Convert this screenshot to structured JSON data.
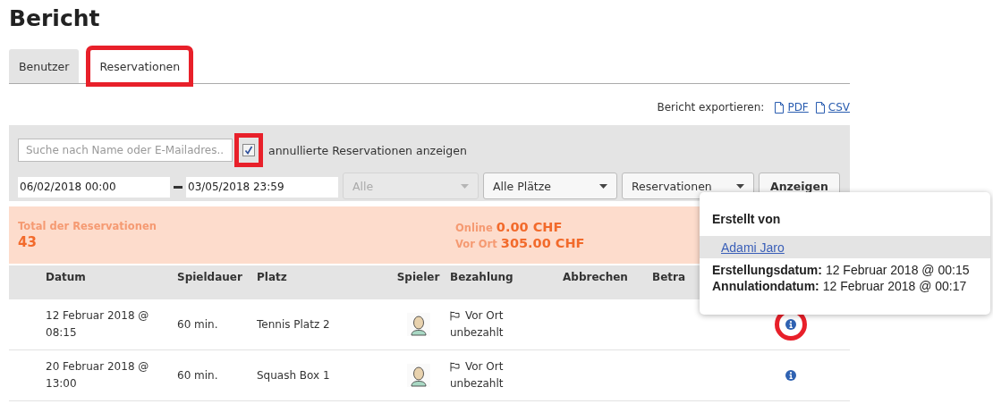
{
  "page_title": "Bericht",
  "tabs": [
    {
      "label": "Benutzer",
      "selected": false,
      "highlighted": false
    },
    {
      "label": "Reservationen",
      "selected": true,
      "highlighted": true
    }
  ],
  "export": {
    "label": "Bericht exportieren:",
    "links": [
      "PDF",
      "CSV"
    ]
  },
  "filters": {
    "search": {
      "placeholder": "Suche nach Name oder E-Mailadres..."
    },
    "show_cancelled": {
      "label": "annullierte Reservationen anzeigen",
      "checked": true,
      "highlighted": true
    },
    "date_from": "06/02/2018 00:00",
    "date_to": "03/05/2018 23:59",
    "selects": [
      {
        "value": "Alle",
        "disabled": true
      },
      {
        "value": "Alle Plätze",
        "disabled": false
      },
      {
        "value": "Reservationen",
        "disabled": false
      }
    ],
    "submit": "Anzeigen"
  },
  "summary": {
    "total_label": "Total der Reservationen",
    "total": "43",
    "amounts": [
      {
        "label": "Online",
        "value": "0.00 CHF"
      },
      {
        "label": "Vor Ort",
        "value": "305.00 CHF"
      }
    ]
  },
  "table": {
    "columns": [
      "Datum",
      "Spieldauer",
      "Platz",
      "Spieler",
      "Bezahlung",
      "Abbrechen",
      "Betra"
    ],
    "rows": [
      {
        "date": "12 Februar 2018 @ 08:15",
        "duration": "60 min.",
        "court": "Tennis Platz 2",
        "payment_method": "Vor Ort",
        "payment_status": "unbezahlt",
        "highlighted": true
      },
      {
        "date": "20 Februar 2018 @ 13:00",
        "duration": "60 min.",
        "court": "Squash Box 1",
        "payment_method": "Vor Ort",
        "payment_status": "unbezahlt",
        "highlighted": false
      }
    ]
  },
  "popover": {
    "title": "Erstellt von",
    "user": "Adami Jaro",
    "details": [
      {
        "label": "Erstellungsdatum:",
        "value": "12 Februar 2018 @ 00:15"
      },
      {
        "label": "Annulationdatum:",
        "value": "12 Februar 2018 @ 00:17"
      }
    ]
  }
}
